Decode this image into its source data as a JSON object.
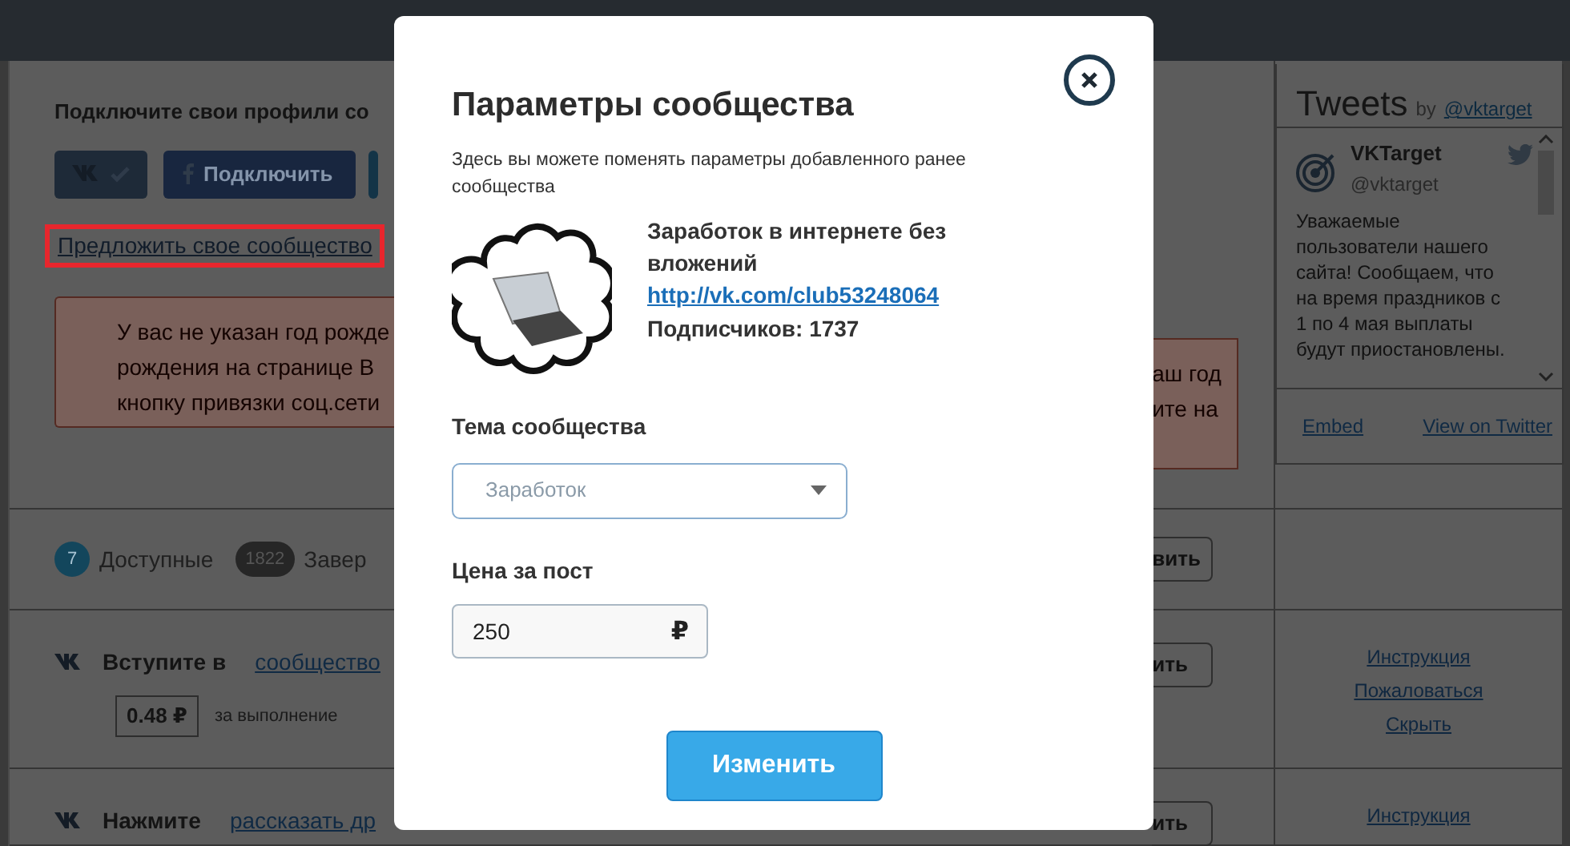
{
  "main": {
    "heading": "Подключите свои профили со",
    "social_buttons": [
      {
        "kind": "vk-connected"
      },
      {
        "kind": "facebook",
        "label": "Подключить"
      },
      {
        "kind": "partial"
      }
    ],
    "suggest_link": {
      "label": "Предложить свое сообщество",
      "highlighted": true
    },
    "alert_left": [
      "У вас не указан год рожде",
      "рождения на странице В",
      "кнопку привязки соц.сети"
    ],
    "alert_right": [
      "аш год",
      "ите на"
    ],
    "tabs": [
      {
        "count": "7",
        "label": "Доступные",
        "selected": true
      },
      {
        "count": "1822",
        "label": "Завер",
        "selected": false
      }
    ],
    "tabs_button": "вить",
    "tasks": [
      {
        "action": "Вступите в",
        "link": "сообщество",
        "price": "0.48 ₽",
        "price_note": "за выполнение",
        "button": "ить",
        "links": [
          "Инструкция",
          "Пожаловаться",
          "Скрыть"
        ]
      },
      {
        "action": "Нажмите",
        "link": "рассказать др",
        "button": "ить",
        "links": [
          "Инструкция"
        ]
      }
    ]
  },
  "twitter": {
    "title": "Tweets",
    "by": "by",
    "handle": "@vktarget",
    "tweet": {
      "name": "VKTarget",
      "handle": "@vktarget",
      "text": "Уважаемые пользователи нашего сайта! Сообщаем, что на время праздников с 1 по 4 мая выплаты будут приостановлены."
    },
    "footer": [
      "Embed",
      "View on Twitter"
    ]
  },
  "modal": {
    "title": "Параметры сообщества",
    "description": "Здесь вы можете поменять параметры добавленного ранее сообщества",
    "community": {
      "name": "Заработок в интернете без вложений",
      "url": "http://vk.com/club53248064",
      "subscribers": "Подписчиков: 1737"
    },
    "topic": {
      "label": "Тема сообщества",
      "value": "Заработок"
    },
    "price": {
      "label": "Цена за пост",
      "value": "250",
      "currency": "₽"
    },
    "submit": "Изменить"
  }
}
